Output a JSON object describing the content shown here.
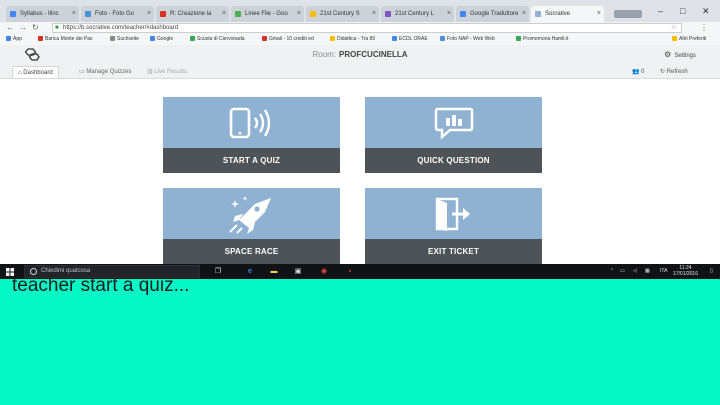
{
  "browser": {
    "tabs": [
      {
        "label": "Syllabus - Ilinc",
        "fav": "#4285f4"
      },
      {
        "label": "Foto - Foto Go",
        "fav": "#4a90d9"
      },
      {
        "label": "R: Creazione la",
        "fav": "#d93025"
      },
      {
        "label": "Linee File - Goo",
        "fav": "#4caf50"
      },
      {
        "label": "21st Century S",
        "fav": "#fbbc04"
      },
      {
        "label": "21st Century L",
        "fav": "#7e57c2"
      },
      {
        "label": "Google Traduttore",
        "fav": "#4285f4"
      },
      {
        "label": "Socrative",
        "fav": "#8fb2d3",
        "active": true
      }
    ],
    "url": "https://b.socrative.com/teacher/#dashboard",
    "bookmarks": [
      {
        "label": "App",
        "color": "#4285f4"
      },
      {
        "label": "Banca Monte dei Pas",
        "color": "#d93025"
      },
      {
        "label": "Suchseite",
        "color": "#888888"
      },
      {
        "label": "Google",
        "color": "#4285f4"
      },
      {
        "label": "Scuola di Ciervonada",
        "color": "#34a853"
      },
      {
        "label": "Gmail - 10 crediti ed",
        "color": "#d93025"
      },
      {
        "label": "Didattica - Tra 89",
        "color": "#fbbc04"
      },
      {
        "label": "ECDL ORAE",
        "color": "#4285f4"
      },
      {
        "label": "Foto NAP - Web Web",
        "color": "#4a90d9"
      },
      {
        "label": "Promemoria Hamit.it",
        "color": "#34a853"
      },
      {
        "label": "Altri Preferiti",
        "color": "#fbbc04"
      }
    ]
  },
  "app": {
    "room_label": "Room:",
    "room_name": "PROFCUCINELLA",
    "settings_label": "Settings",
    "nav": {
      "dashboard": "Dashboard",
      "manage_quizzes": "Manage Quizzes",
      "live_results": "Live Results",
      "students_count": "0",
      "refresh": "Refresh"
    },
    "tiles": {
      "start_quiz": "START A QUIZ",
      "quick_question": "QUICK QUESTION",
      "space_race": "SPACE RACE",
      "exit_ticket": "EXIT TICKET"
    }
  },
  "taskbar": {
    "search_placeholder": "Chiedimi qualcosa",
    "language": "ITA",
    "time": "11:24",
    "date": "17/01/2016"
  },
  "caption": "teacher start a quiz..."
}
